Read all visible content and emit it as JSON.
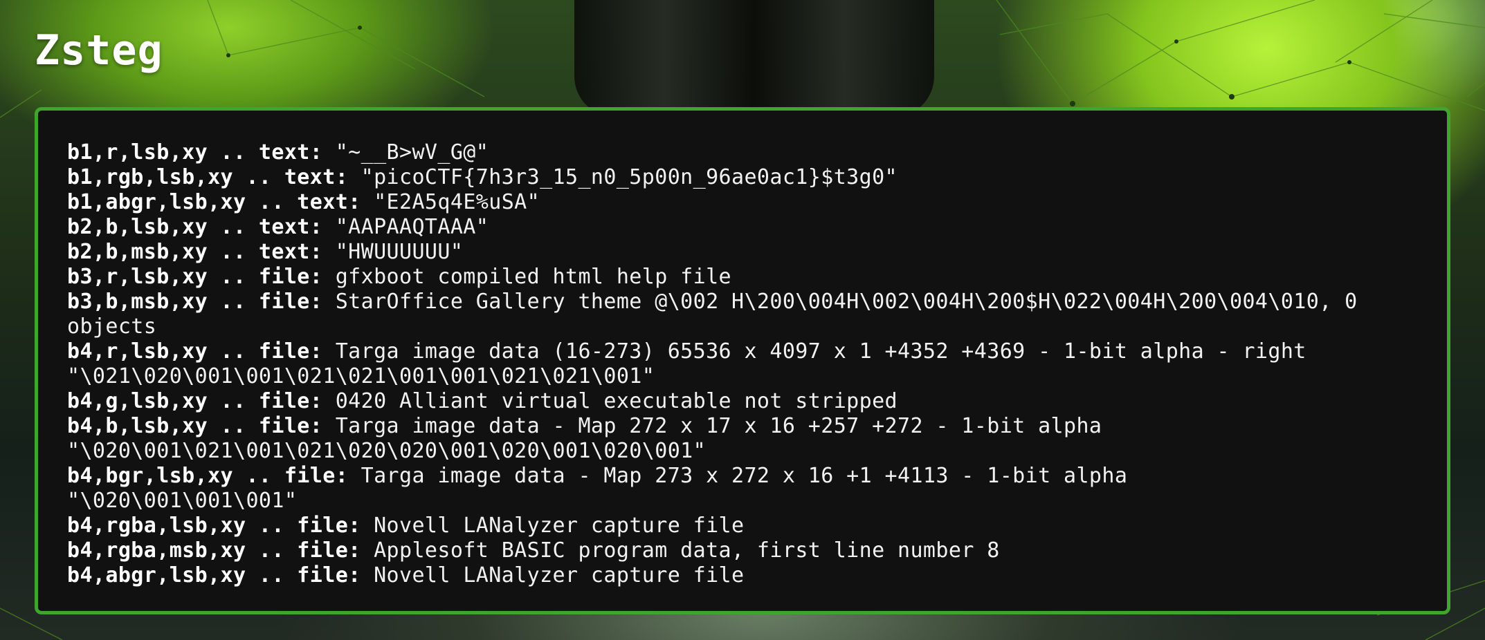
{
  "page": {
    "title": "Zsteg"
  },
  "output": [
    {
      "key": "b1,r,lsb,xy .. text:",
      "value": " \"~__B>wV_G@\""
    },
    {
      "key": "b1,rgb,lsb,xy .. text:",
      "value": " \"picoCTF{7h3r3_15_n0_5p00n_96ae0ac1}$t3g0\""
    },
    {
      "key": "b1,abgr,lsb,xy .. text:",
      "value": " \"E2A5q4E%uSA\""
    },
    {
      "key": "b2,b,lsb,xy .. text:",
      "value": " \"AAPAAQTAAA\""
    },
    {
      "key": "b2,b,msb,xy .. text:",
      "value": " \"HWUUUUUU\""
    },
    {
      "key": "b3,r,lsb,xy .. file:",
      "value": " gfxboot compiled html help file"
    },
    {
      "key": "b3,b,msb,xy .. file:",
      "value": " StarOffice Gallery theme @\\002 H\\200\\004H\\002\\004H\\200$H\\022\\004H\\200\\004\\010, 0",
      "cont": "objects"
    },
    {
      "key": "b4,r,lsb,xy .. file:",
      "value": " Targa image data (16-273) 65536 x 4097 x 1 +4352 +4369 - 1-bit alpha - right",
      "cont": "\"\\021\\020\\001\\001\\021\\021\\001\\001\\021\\021\\001\""
    },
    {
      "key": "b4,g,lsb,xy .. file:",
      "value": " 0420 Alliant virtual executable not stripped"
    },
    {
      "key": "b4,b,lsb,xy .. file:",
      "value": " Targa image data - Map 272 x 17 x 16 +257 +272 - 1-bit alpha",
      "cont": "\"\\020\\001\\021\\001\\021\\020\\020\\001\\020\\001\\020\\001\""
    },
    {
      "key": "b4,bgr,lsb,xy .. file:",
      "value": " Targa image data - Map 273 x 272 x 16 +1 +4113 - 1-bit alpha",
      "cont": "\"\\020\\001\\001\\001\""
    },
    {
      "key": "b4,rgba,lsb,xy .. file:",
      "value": " Novell LANalyzer capture file"
    },
    {
      "key": "b4,rgba,msb,xy .. file:",
      "value": " Applesoft BASIC program data, first line number 8"
    },
    {
      "key": "b4,abgr,lsb,xy .. file:",
      "value": " Novell LANalyzer capture file"
    }
  ],
  "colors": {
    "accent_border": "#3fa52f",
    "terminal_bg": "#101110",
    "text": "#f2f2f2"
  }
}
